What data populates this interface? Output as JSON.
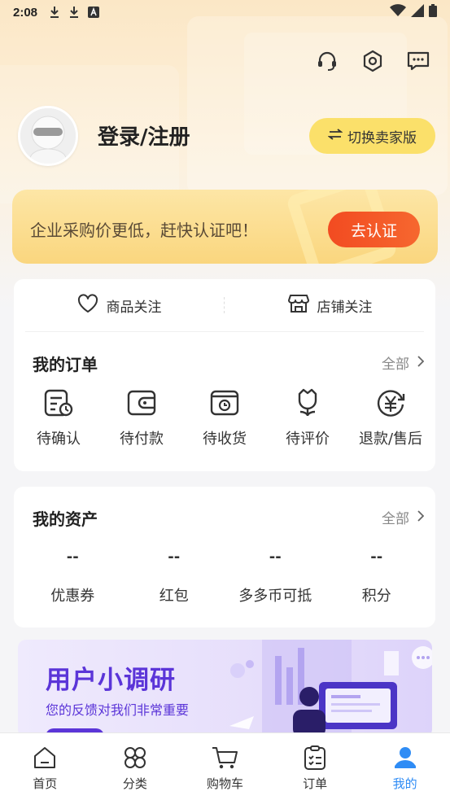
{
  "status_bar": {
    "time": "2:08"
  },
  "header": {
    "login_text": "登录/注册",
    "switch_label": "切换卖家版"
  },
  "promo": {
    "text": "企业采购价更低，赶快认证吧！",
    "button": "去认证"
  },
  "follow": {
    "items": [
      {
        "label": "商品关注",
        "icon": "heart-icon"
      },
      {
        "label": "店铺关注",
        "icon": "store-icon"
      }
    ]
  },
  "orders": {
    "title": "我的订单",
    "all": "全部",
    "items": [
      {
        "label": "待确认",
        "icon": "pending-confirm-icon"
      },
      {
        "label": "待付款",
        "icon": "wallet-icon"
      },
      {
        "label": "待收货",
        "icon": "package-icon"
      },
      {
        "label": "待评价",
        "icon": "flower-icon"
      },
      {
        "label": "退款/售后",
        "icon": "refund-icon"
      }
    ]
  },
  "assets": {
    "title": "我的资产",
    "all": "全部",
    "items": [
      {
        "value": "--",
        "label": "优惠券"
      },
      {
        "value": "--",
        "label": "红包"
      },
      {
        "value": "--",
        "label": "多多币可抵"
      },
      {
        "value": "--",
        "label": "积分"
      }
    ]
  },
  "survey": {
    "title": "用户小调研",
    "subtitle": "您的反馈对我们非常重要"
  },
  "tabbar": {
    "active_color": "#2f8cf5",
    "items": [
      {
        "label": "首页",
        "icon": "home-icon"
      },
      {
        "label": "分类",
        "icon": "category-icon"
      },
      {
        "label": "购物车",
        "icon": "cart-icon"
      },
      {
        "label": "订单",
        "icon": "order-clipboard-icon"
      },
      {
        "label": "我的",
        "icon": "user-icon",
        "active": true
      }
    ]
  }
}
